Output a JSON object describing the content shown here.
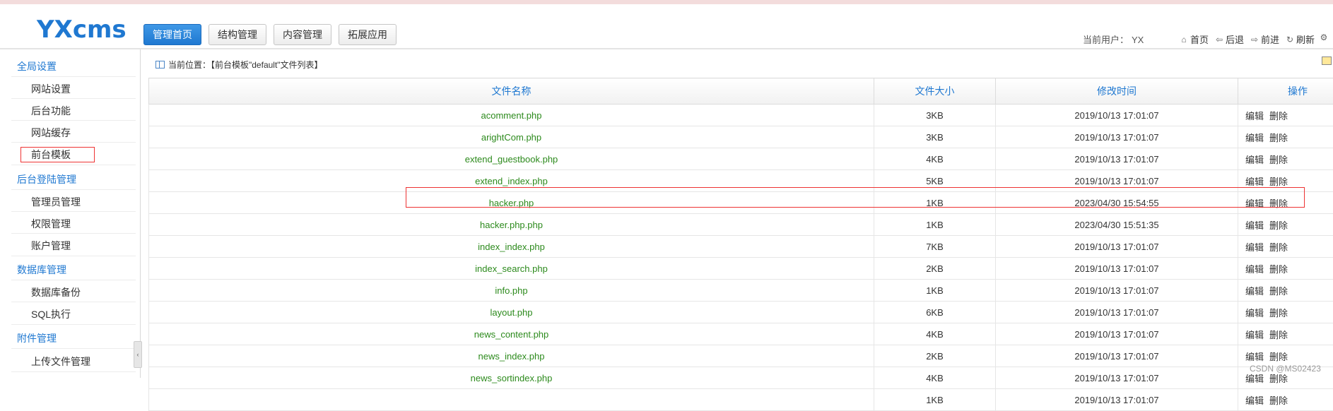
{
  "logo": "YXcms",
  "nav": [
    "管理首页",
    "结构管理",
    "内容管理",
    "拓展应用"
  ],
  "current_user_label": "当前用户：",
  "current_user": "YX",
  "header_links": [
    {
      "label": "首页",
      "icon": "home-icon"
    },
    {
      "label": "后退",
      "icon": "back-icon"
    },
    {
      "label": "前进",
      "icon": "forward-icon"
    },
    {
      "label": "刷新",
      "icon": "refresh-icon"
    }
  ],
  "sidebar": {
    "groups": [
      {
        "title": "全局设置",
        "items": [
          "网站设置",
          "后台功能",
          "网站缓存",
          "前台模板"
        ]
      },
      {
        "title": "后台登陆管理",
        "items": [
          "管理员管理",
          "权限管理",
          "账户管理"
        ]
      },
      {
        "title": "数据库管理",
        "items": [
          "数据库备份",
          "SQL执行"
        ]
      },
      {
        "title": "附件管理",
        "items": [
          "上传文件管理"
        ]
      }
    ]
  },
  "location": "当前位置：【前台模板\"default\"文件列表】",
  "table": {
    "headers": [
      "文件名称",
      "文件大小",
      "修改时间",
      "操作"
    ],
    "action_labels": [
      "编辑",
      "删除"
    ],
    "rows": [
      {
        "name": "acomment.php",
        "size": "3KB",
        "time": "2019/10/13 17:01:07"
      },
      {
        "name": "arightCom.php",
        "size": "3KB",
        "time": "2019/10/13 17:01:07"
      },
      {
        "name": "extend_guestbook.php",
        "size": "4KB",
        "time": "2019/10/13 17:01:07"
      },
      {
        "name": "extend_index.php",
        "size": "5KB",
        "time": "2019/10/13 17:01:07"
      },
      {
        "name": "hacker.php",
        "size": "1KB",
        "time": "2023/04/30 15:54:55"
      },
      {
        "name": "hacker.php.php",
        "size": "1KB",
        "time": "2023/04/30 15:51:35"
      },
      {
        "name": "index_index.php",
        "size": "7KB",
        "time": "2019/10/13 17:01:07"
      },
      {
        "name": "index_search.php",
        "size": "2KB",
        "time": "2019/10/13 17:01:07"
      },
      {
        "name": "info.php",
        "size": "1KB",
        "time": "2019/10/13 17:01:07"
      },
      {
        "name": "layout.php",
        "size": "6KB",
        "time": "2019/10/13 17:01:07"
      },
      {
        "name": "news_content.php",
        "size": "4KB",
        "time": "2019/10/13 17:01:07"
      },
      {
        "name": "news_index.php",
        "size": "2KB",
        "time": "2019/10/13 17:01:07"
      },
      {
        "name": "news_sortindex.php",
        "size": "4KB",
        "time": "2019/10/13 17:01:07"
      },
      {
        "name": "",
        "size": "1KB",
        "time": "2019/10/13 17:01:07"
      }
    ]
  },
  "watermark": "CSDN @MS02423",
  "colors": {
    "accent": "#1f78d1",
    "file_name": "#2c8a1c",
    "highlight_border": "#ee3333"
  }
}
